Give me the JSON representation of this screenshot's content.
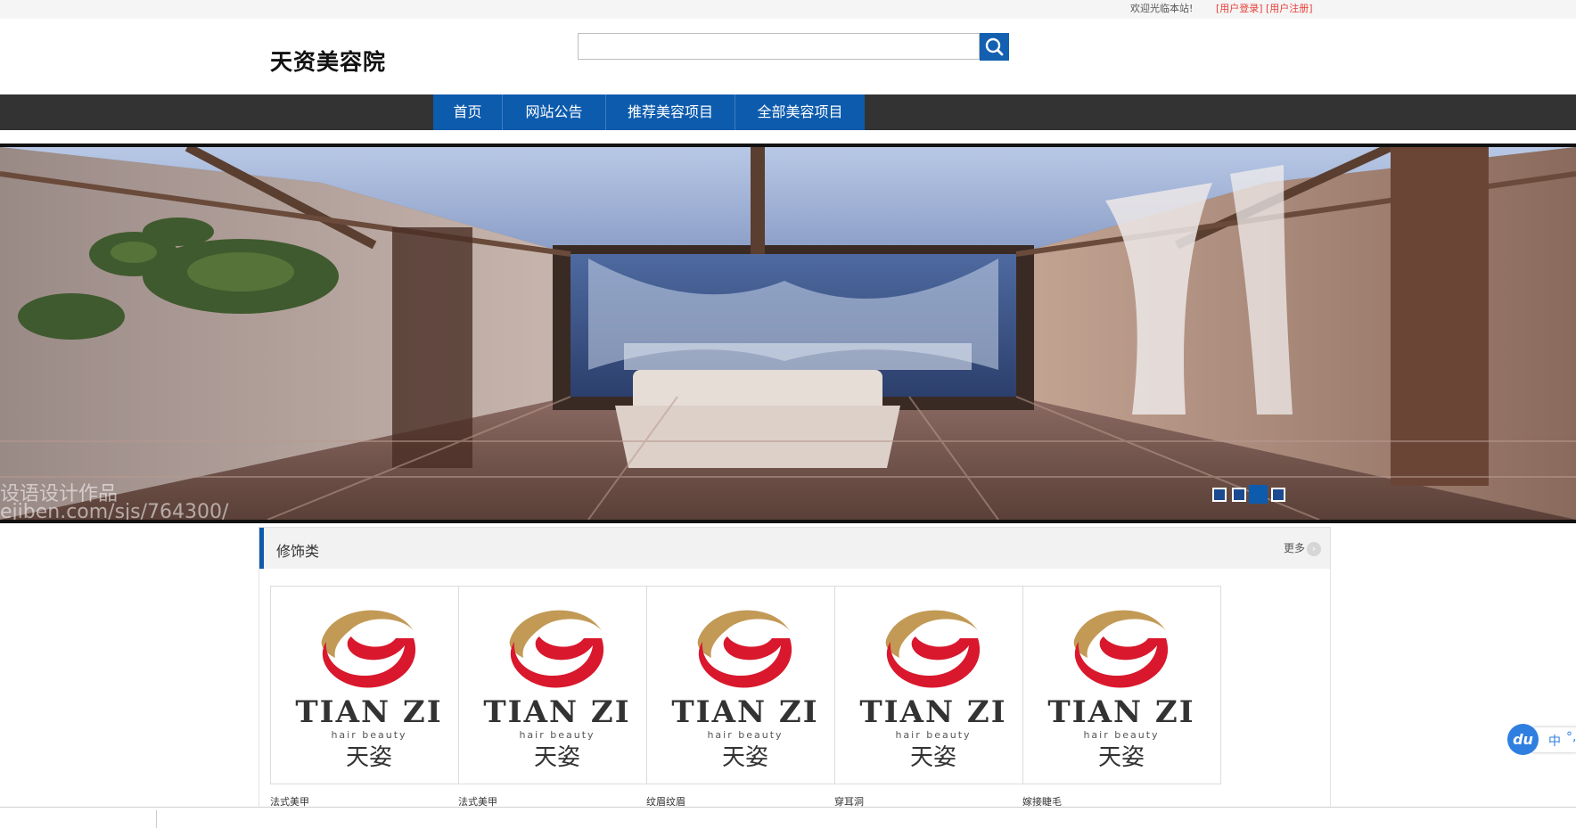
{
  "topbar": {
    "welcome": "欢迎光临本站!",
    "login": "[用户登录]",
    "register": "[用户注册]"
  },
  "header": {
    "logo_text": "天资美容院",
    "search": {
      "value": "",
      "placeholder": ""
    }
  },
  "nav": {
    "items": [
      {
        "label": "首页"
      },
      {
        "label": "网站公告"
      },
      {
        "label": "推荐美容项目"
      },
      {
        "label": "全部美容项目"
      }
    ]
  },
  "banner": {
    "watermark_line1": "设语设计作品",
    "watermark_line2": "ejiben.com/sjs/764300/",
    "slide_count": 4,
    "active_slide": 3
  },
  "section": {
    "title": "修饰类",
    "more": "更多",
    "products": [
      {
        "label": "法式美甲",
        "logo_main": "TIAN ZI",
        "logo_sub": "hair beauty",
        "logo_cn": "天姿"
      },
      {
        "label": "法式美甲",
        "logo_main": "TIAN ZI",
        "logo_sub": "hair beauty",
        "logo_cn": "天姿"
      },
      {
        "label": "纹眉纹眉",
        "logo_main": "TIAN ZI",
        "logo_sub": "hair beauty",
        "logo_cn": "天姿"
      },
      {
        "label": "穿耳洞",
        "logo_main": "TIAN ZI",
        "logo_sub": "hair beauty",
        "logo_cn": "天姿"
      },
      {
        "label": "嫁接睫毛",
        "logo_main": "TIAN ZI",
        "logo_sub": "hair beauty",
        "logo_cn": "天姿"
      }
    ]
  },
  "ime": {
    "badge": "du",
    "mode": "中",
    "punct": "°,"
  },
  "colors": {
    "brand_blue": "#0d5bad",
    "nav_bg": "#333333",
    "link_red": "#e8403a",
    "logo_gold": "#c29a56",
    "logo_red": "#d9182d"
  },
  "icons": {
    "search": "search-icon",
    "more": "chevron-right-icon",
    "ime": "baidu-ime-icon"
  }
}
